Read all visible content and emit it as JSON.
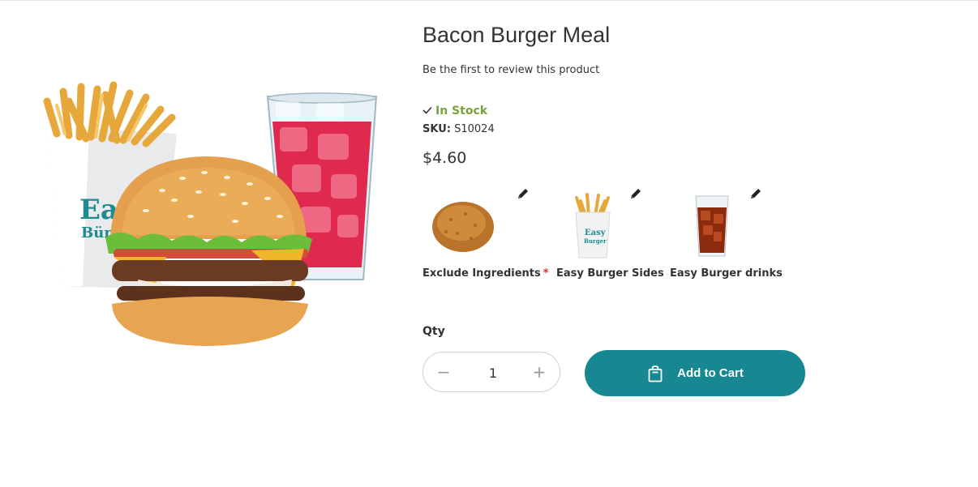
{
  "product": {
    "title": "Bacon Burger Meal",
    "review_link": "Be the first to review this product",
    "stock_status": "In Stock",
    "sku_label": "SKU:",
    "sku_value": "S10024",
    "price": "$4.60",
    "image_icon": "burger-meal-image"
  },
  "options": [
    {
      "label": "Exclude Ingredients",
      "required_marker": "*",
      "icon": "croquette-thumbnail",
      "edit_icon": "pencil-icon"
    },
    {
      "label": "Easy Burger Sides",
      "icon": "fries-thumbnail",
      "edit_icon": "pencil-icon"
    },
    {
      "label": "Easy Burger drinks",
      "icon": "soda-thumbnail",
      "edit_icon": "pencil-icon"
    }
  ],
  "quantity": {
    "label": "Qty",
    "value": "1",
    "minus_symbol": "−",
    "plus_symbol": "+"
  },
  "cart": {
    "button_label": "Add to Cart",
    "icon": "shopping-bag-icon"
  },
  "colors": {
    "accent": "#178891",
    "in_stock": "#7aa33b",
    "required": "#e02b27",
    "text": "#333333"
  }
}
